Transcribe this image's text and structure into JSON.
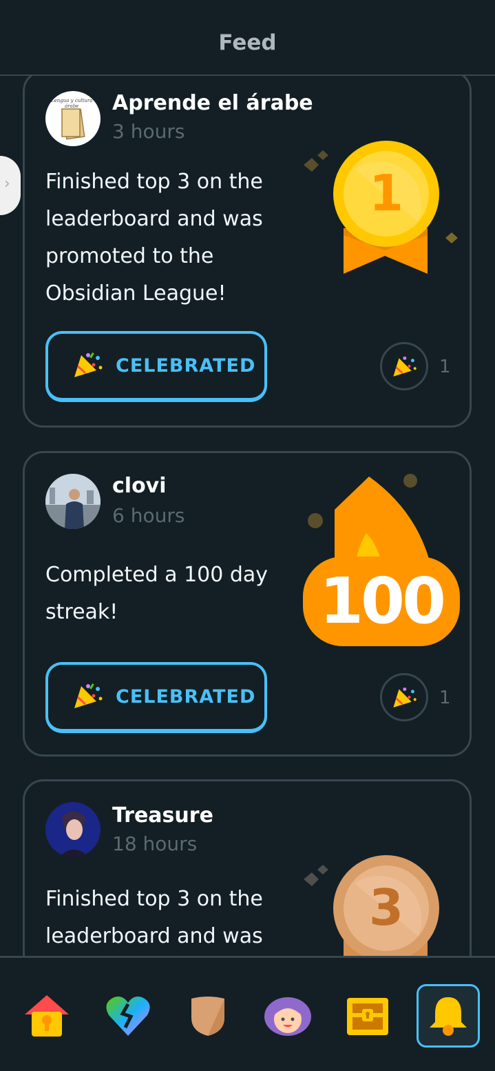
{
  "header": {
    "title": "Feed"
  },
  "posts": [
    {
      "name": "Aprende el árabe",
      "time": "3 hours",
      "message": "Finished top 3 on the leaderboard and was promoted to the Obsidian League!",
      "badge": "1",
      "button_label": "CELEBRATED",
      "reaction_count": "1"
    },
    {
      "name": "clovi",
      "time": "6 hours",
      "message": "Completed a 100 day streak!",
      "badge": "100",
      "button_label": "CELEBRATED",
      "reaction_count": "1"
    },
    {
      "name": "Treasure",
      "time": "18 hours",
      "message": "Finished top 3 on the leaderboard and was",
      "badge": "3"
    }
  ],
  "tabs": [
    {
      "icon": "home-icon"
    },
    {
      "icon": "heart-icon"
    },
    {
      "icon": "shield-icon"
    },
    {
      "icon": "profile-icon"
    },
    {
      "icon": "treasure-chest-icon"
    },
    {
      "icon": "bell-icon",
      "active": true
    }
  ],
  "colors": {
    "background": "#131f24",
    "border": "#37464f",
    "accent": "#49c0f8",
    "gold": "#ffc800",
    "orange": "#ff9600",
    "bronze": "#e0a978"
  }
}
